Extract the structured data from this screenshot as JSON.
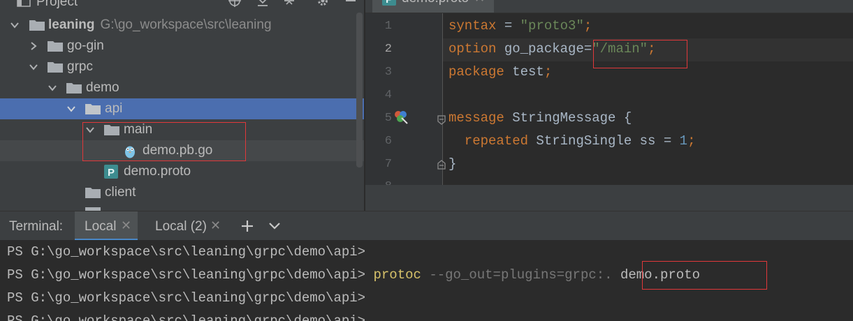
{
  "project_panel": {
    "title": "Project",
    "tree": [
      {
        "label": "leaning",
        "path": "G:\\go_workspace\\src\\leaning"
      },
      {
        "label": "go-gin"
      },
      {
        "label": "grpc"
      },
      {
        "label": "demo"
      },
      {
        "label": "api"
      },
      {
        "label": "main"
      },
      {
        "label": "demo.pb.go"
      },
      {
        "label": "demo.proto"
      },
      {
        "label": "client"
      }
    ]
  },
  "editor": {
    "tab_label": "demo.proto",
    "line_numbers": [
      "1",
      "2",
      "3",
      "4",
      "5",
      "6",
      "7"
    ],
    "code": {
      "l1_kw": "syntax",
      "l1_op": " = ",
      "l1_str": "\"proto3\"",
      "l1_end": ";",
      "l2_kw": "option",
      "l2_mid": " go_package=",
      "l2_str": "\"/main\"",
      "l2_end": ";",
      "l3_kw": "package",
      "l3_mid": " test",
      "l3_end": ";",
      "l5_kw": "message",
      "l5_mid": " StringMessage {",
      "l6_kw": "  repeated",
      "l6_mid": " StringSingle ss = ",
      "l6_num": "1",
      "l6_end": ";",
      "l7": "}"
    },
    "accent_color": "#cc7832"
  },
  "terminal": {
    "header_label": "Terminal:",
    "tabs": [
      {
        "label": "Local"
      },
      {
        "label": "Local (2)"
      }
    ],
    "lines": {
      "line1": "PS G:\\go_workspace\\src\\leaning\\grpc\\demo\\api>",
      "line2_prompt": "PS G:\\go_workspace\\src\\leaning\\grpc\\demo\\api> ",
      "line2_cmd": "protoc",
      "line2_args": " --go_out=plugins=grpc:.",
      "line2_file": " demo.proto",
      "line3": "PS G:\\go_workspace\\src\\leaning\\grpc\\demo\\api>",
      "line4": "PS G:\\go_workspace\\src\\leaning\\grpc\\demo\\api>"
    }
  },
  "colors": {
    "selection": "#4b6eaf",
    "annotation": "#e0383a"
  }
}
